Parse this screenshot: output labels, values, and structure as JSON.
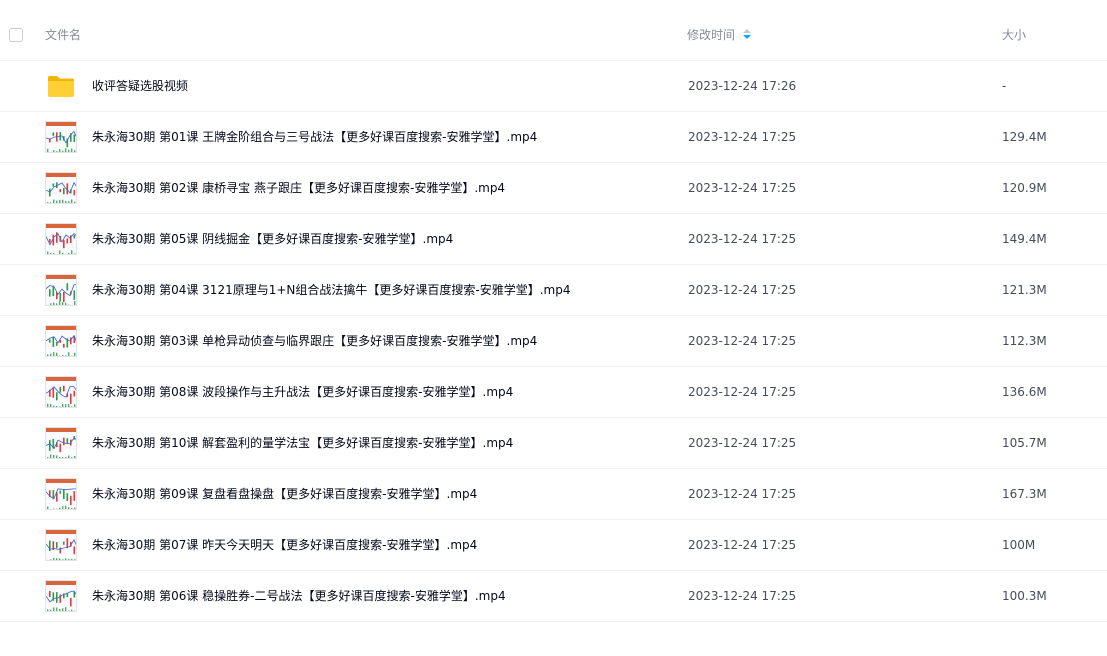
{
  "header": {
    "name_label": "文件名",
    "time_label": "修改时间",
    "size_label": "大小",
    "sort_icon": "sort-desc-icon",
    "sort_color": "#06a7ff"
  },
  "files": [
    {
      "name": "收评答疑选股视频",
      "time": "2023-12-24 17:26",
      "size": "-",
      "icon": "folder-icon"
    },
    {
      "name": "朱永海30期 第01课 王牌金阶组合与三号战法【更多好课百度搜索-安雅学堂】.mp4",
      "time": "2023-12-24 17:25",
      "size": "129.4M",
      "icon": "video-thumbnail"
    },
    {
      "name": "朱永海30期 第02课 康桥寻宝 燕子跟庄【更多好课百度搜索-安雅学堂】.mp4",
      "time": "2023-12-24 17:25",
      "size": "120.9M",
      "icon": "video-thumbnail"
    },
    {
      "name": "朱永海30期 第05课 阴线掘金【更多好课百度搜索-安雅学堂】.mp4",
      "time": "2023-12-24 17:25",
      "size": "149.4M",
      "icon": "video-thumbnail"
    },
    {
      "name": "朱永海30期 第04课 3121原理与1+N组合战法擒牛【更多好课百度搜索-安雅学堂】.mp4",
      "time": "2023-12-24 17:25",
      "size": "121.3M",
      "icon": "video-thumbnail"
    },
    {
      "name": "朱永海30期 第03课 单枪异动侦查与临界跟庄【更多好课百度搜索-安雅学堂】.mp4",
      "time": "2023-12-24 17:25",
      "size": "112.3M",
      "icon": "video-thumbnail"
    },
    {
      "name": "朱永海30期 第08课 波段操作与主升战法【更多好课百度搜索-安雅学堂】.mp4",
      "time": "2023-12-24 17:25",
      "size": "136.6M",
      "icon": "video-thumbnail"
    },
    {
      "name": "朱永海30期 第10课 解套盈利的量学法宝【更多好课百度搜索-安雅学堂】.mp4",
      "time": "2023-12-24 17:25",
      "size": "105.7M",
      "icon": "video-thumbnail"
    },
    {
      "name": "朱永海30期 第09课 复盘看盘操盘【更多好课百度搜索-安雅学堂】.mp4",
      "time": "2023-12-24 17:25",
      "size": "167.3M",
      "icon": "video-thumbnail"
    },
    {
      "name": "朱永海30期 第07课 昨天今天明天【更多好课百度搜索-安雅学堂】.mp4",
      "time": "2023-12-24 17:25",
      "size": "100M",
      "icon": "video-thumbnail"
    },
    {
      "name": "朱永海30期 第06课 稳操胜券-二号战法【更多好课百度搜索-安雅学堂】.mp4",
      "time": "2023-12-24 17:25",
      "size": "100.3M",
      "icon": "video-thumbnail"
    }
  ]
}
